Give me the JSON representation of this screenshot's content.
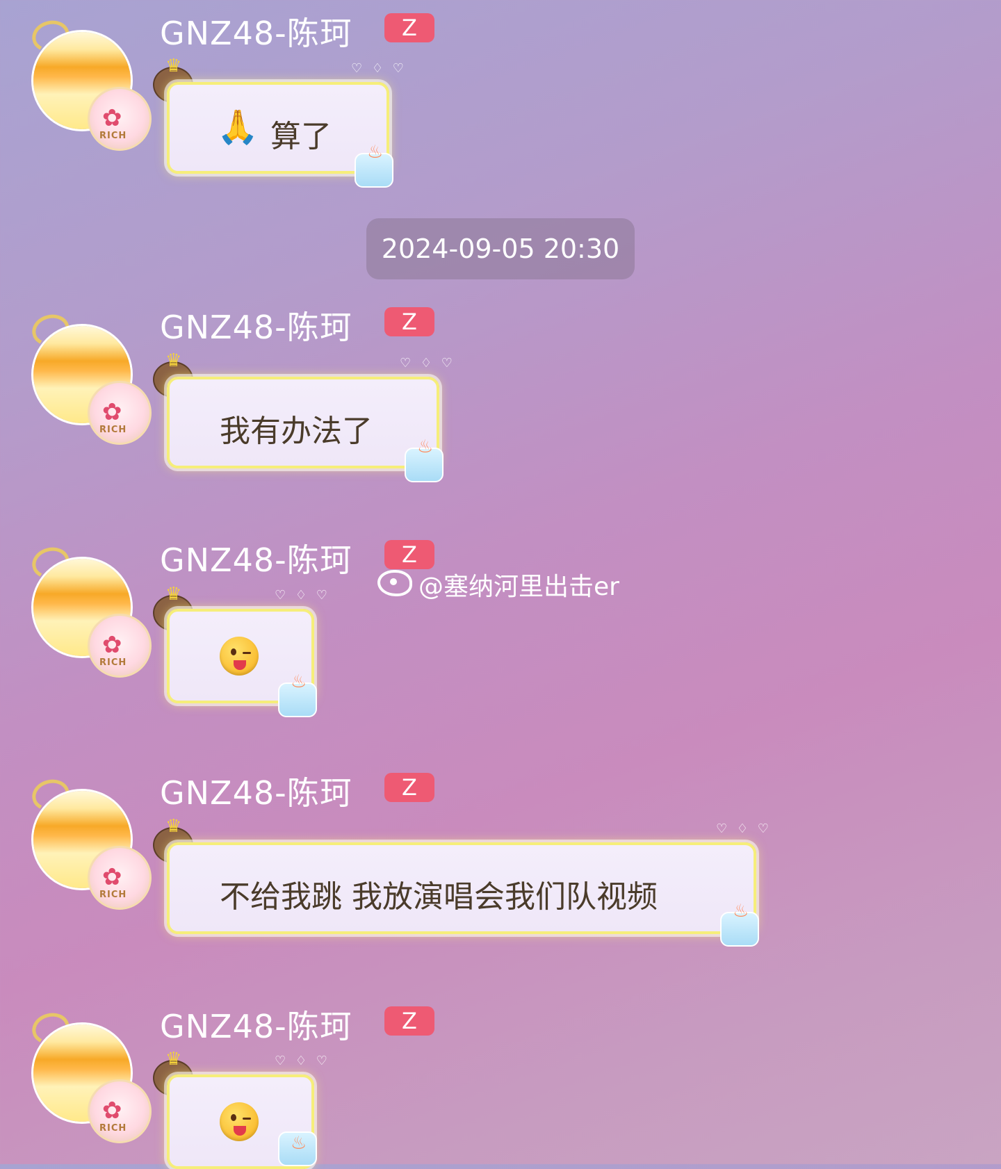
{
  "sender_name": "GNZ48-陈珂",
  "badge_label": "Z",
  "frame_label": "RICH",
  "timestamp": "2024-09-05 20:30",
  "watermark": "@塞纳河里出击er",
  "messages": [
    {
      "kind": "text",
      "text": "算了",
      "has_pray_emoji": true
    },
    {
      "kind": "text",
      "text": "我有办法了"
    },
    {
      "kind": "emoji",
      "emoji": "winking-face-with-tongue"
    },
    {
      "kind": "text",
      "text": "不给我跳 我放演唱会我们队视频"
    },
    {
      "kind": "emoji",
      "emoji": "winking-face-with-tongue"
    }
  ],
  "colors": {
    "badge": "#ee5a73",
    "bubble_border": "#f6ee7a",
    "bubble_fill": "#f4eefb",
    "text": "#4a3b2a"
  }
}
